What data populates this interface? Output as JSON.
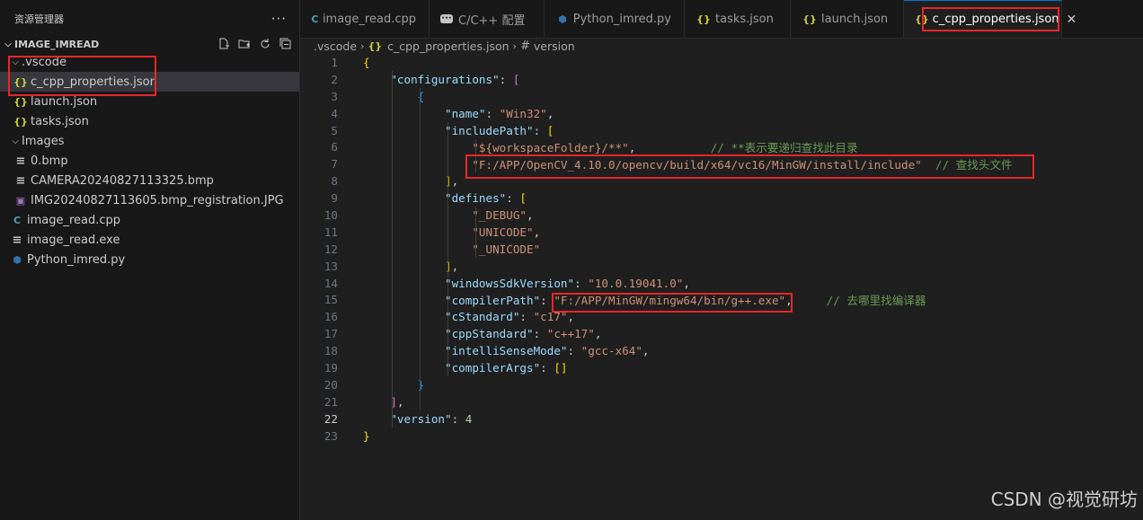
{
  "sidebar": {
    "header_title": "资源管理器",
    "more_label": "···",
    "section_title": "IMAGE_IMREAD",
    "tree": [
      {
        "label": ".vscode",
        "type": "folder",
        "indent": 1
      },
      {
        "label": "c_cpp_properties.json",
        "type": "json",
        "indent": 2,
        "selected": true
      },
      {
        "label": "launch.json",
        "type": "json",
        "indent": 2
      },
      {
        "label": "tasks.json",
        "type": "json",
        "indent": 2
      },
      {
        "label": "Images",
        "type": "folder",
        "indent": 1
      },
      {
        "label": "0.bmp",
        "type": "bmp",
        "indent": 2
      },
      {
        "label": "CAMERA20240827113325.bmp",
        "type": "bmp",
        "indent": 2
      },
      {
        "label": "IMG20240827113605.bmp_registration.JPG",
        "type": "jpg",
        "indent": 2
      },
      {
        "label": "image_read.cpp",
        "type": "cpp",
        "indent": 1
      },
      {
        "label": "image_read.exe",
        "type": "exe",
        "indent": 1
      },
      {
        "label": "Python_imred.py",
        "type": "py",
        "indent": 1
      }
    ]
  },
  "tabs": [
    {
      "label": "image_read.cpp",
      "icon": "cpp"
    },
    {
      "label": "C/C++ 配置",
      "icon": "settings-badge"
    },
    {
      "label": "Python_imred.py",
      "icon": "py"
    },
    {
      "label": "tasks.json",
      "icon": "json"
    },
    {
      "label": "launch.json",
      "icon": "json"
    },
    {
      "label": "c_cpp_properties.json",
      "icon": "json",
      "active": true
    }
  ],
  "breadcrumb": {
    "folder": ".vscode",
    "file": "c_cpp_properties.json",
    "symbol": "version"
  },
  "editor": {
    "current_line": 22,
    "lines": [
      "{",
      "    \"configurations\": [",
      "        {",
      "            \"name\": \"Win32\",",
      "            \"includePath\": [",
      "                \"${workspaceFolder}/**\",           // **表示要递归查找此目录",
      "                \"F:/APP/OpenCV_4.10.0/opencv/build/x64/vc16/MinGW/install/include\"  // 查找头文件",
      "            ],",
      "            \"defines\": [",
      "                \"_DEBUG\",",
      "                \"UNICODE\",",
      "                \"_UNICODE\"",
      "            ],",
      "            \"windowsSdkVersion\": \"10.0.19041.0\",",
      "            \"compilerPath\": \"F:/APP/MinGW/mingw64/bin/g++.exe\",     // 去哪里找编译器",
      "            \"cStandard\": \"c17\",",
      "            \"cppStandard\": \"c++17\",",
      "            \"intelliSenseMode\": \"gcc-x64\",",
      "            \"compilerArgs\": []",
      "        }",
      "    ],",
      "    \"version\": 4",
      "}"
    ]
  },
  "watermark": "CSDN @视觉研坊",
  "colors": {
    "highlight_box": "#e8262b",
    "accent": "#0078d4"
  }
}
